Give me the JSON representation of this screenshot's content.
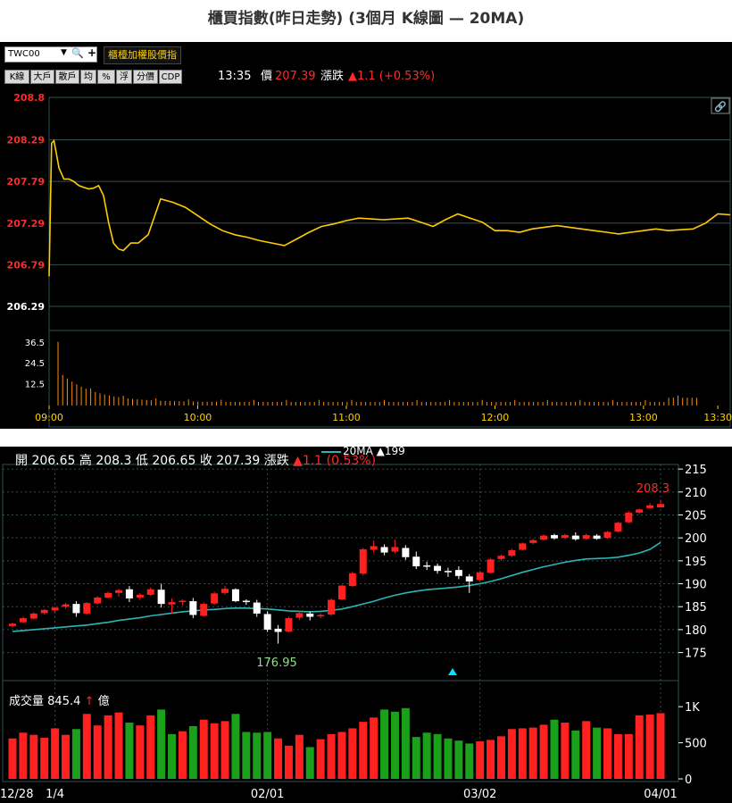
{
  "title": "櫃買指數(昨日走勢) (3個月 K線圖  — 20MA)",
  "top": {
    "symbol_input": "TWC00",
    "dropdown_icon": "▼",
    "search_icon": "🔍",
    "add_icon": "+",
    "name_button": "櫃檯加權股價指",
    "toolbar": [
      "K線",
      "大戶",
      "散戶",
      "均",
      "%",
      "浮",
      "分價",
      "CDP"
    ],
    "quote": {
      "time": "13:35",
      "price_label": "價",
      "price": "207.39",
      "change_label": "漲跌",
      "change": "▲1.1 (+0.53%)"
    },
    "price_ticks": [
      "208.8",
      "208.29",
      "207.79",
      "207.29",
      "206.79",
      "206.29"
    ],
    "volume_ticks": [
      "36.5",
      "24.5",
      "12.5"
    ],
    "time_ticks": [
      "09:00",
      "10:00",
      "11:00",
      "12:00",
      "13:00",
      "13:30"
    ],
    "colors": {
      "price_line": "#ffcc00",
      "volume": "#ff8a00",
      "grid": "#2f5050",
      "axis_text": "#ffd000",
      "price_tick": "#ff2a2a"
    }
  },
  "bottom": {
    "ohlc": {
      "open_label": "開",
      "open": "206.65",
      "high_label": "高",
      "high": "208.3",
      "low_label": "低",
      "low": "206.65",
      "close_label": "收",
      "close": "207.39",
      "change_label": "漲跌",
      "change": "▲1.1 (0.53%)"
    },
    "ma_legend": "20MA",
    "ma_value": "▲199",
    "high_annotation": "208.3",
    "low_annotation": "176.95",
    "price_ticks": [
      "215",
      "210",
      "205",
      "200",
      "195",
      "190",
      "185",
      "180",
      "175"
    ],
    "volume_label": "成交量",
    "volume_value": "845.4",
    "volume_arrow": "↑",
    "volume_unit": "億",
    "volume_ticks": [
      "1K",
      "500",
      "0"
    ],
    "date_ticks": [
      "12/28",
      "1/4",
      "02/01",
      "03/02",
      "04/01"
    ],
    "colors": {
      "up": "#ff2020",
      "down": "#ffffff",
      "ma": "#2bb5b5",
      "vol_up": "#ff2020",
      "vol_down": "#1aa01a"
    }
  },
  "chart_data": [
    {
      "type": "line",
      "title": "",
      "x_label": "",
      "y_label": "",
      "ylim": [
        206.29,
        208.8
      ],
      "x_range": [
        "09:00",
        "13:35"
      ],
      "series": [
        {
          "x": [
            "09:00",
            "09:01",
            "09:02",
            "09:04",
            "09:06",
            "09:08",
            "09:10",
            "09:12",
            "09:14",
            "09:16",
            "09:18",
            "09:20",
            "09:22",
            "09:24",
            "09:26",
            "09:28",
            "09:30",
            "09:33",
            "09:36",
            "09:40",
            "09:45",
            "09:50",
            "09:55",
            "10:00",
            "10:05",
            "10:10",
            "10:15",
            "10:20",
            "10:25",
            "10:30",
            "10:35",
            "10:40",
            "10:45",
            "10:50",
            "10:55",
            "11:00",
            "11:05",
            "11:10",
            "11:15",
            "11:20",
            "11:25",
            "11:30",
            "11:35",
            "11:40",
            "11:45",
            "11:50",
            "11:55",
            "12:00",
            "12:05",
            "12:10",
            "12:15",
            "12:20",
            "12:25",
            "12:30",
            "12:35",
            "12:40",
            "12:45",
            "12:50",
            "12:55",
            "13:00",
            "13:05",
            "13:10",
            "13:15",
            "13:20",
            "13:25",
            "13:30",
            "13:35"
          ],
          "values": [
            206.65,
            208.25,
            208.28,
            207.95,
            207.82,
            207.82,
            207.79,
            207.74,
            207.72,
            207.7,
            207.71,
            207.74,
            207.62,
            207.3,
            207.05,
            206.98,
            206.96,
            207.05,
            207.05,
            207.15,
            207.58,
            207.54,
            207.48,
            207.38,
            207.28,
            207.2,
            207.15,
            207.12,
            207.08,
            207.05,
            207.02,
            207.1,
            207.18,
            207.25,
            207.28,
            207.32,
            207.35,
            207.34,
            207.33,
            207.34,
            207.35,
            207.3,
            207.25,
            207.33,
            207.4,
            207.35,
            207.3,
            207.2,
            207.2,
            207.18,
            207.22,
            207.24,
            207.26,
            207.24,
            207.22,
            207.2,
            207.18,
            207.16,
            207.18,
            207.2,
            207.22,
            207.2,
            207.21,
            207.22,
            207.29,
            207.4,
            207.39
          ]
        }
      ],
      "volume": {
        "ylim": [
          0,
          40
        ],
        "peak_open": 36.5,
        "peak_close": 36.5
      }
    },
    {
      "type": "candlestick",
      "title": "",
      "x_label": "",
      "y_label": "",
      "ylim": [
        172,
        216
      ],
      "x_ticks": [
        "12/28",
        "1/4",
        "02/01",
        "03/02",
        "04/01"
      ],
      "series": [
        {
          "name": "K",
          "ohlc": [
            [
              180.8,
              181.5,
              180.5,
              181.3
            ],
            [
              181.6,
              182.8,
              181.4,
              182.5
            ],
            [
              182.4,
              183.8,
              182.2,
              183.5
            ],
            [
              183.6,
              184.5,
              183.3,
              184.3
            ],
            [
              184.2,
              185.0,
              183.8,
              184.8
            ],
            [
              185.0,
              185.8,
              184.6,
              185.5
            ],
            [
              185.6,
              186.2,
              182.8,
              183.6
            ],
            [
              183.5,
              186.0,
              183.2,
              185.8
            ],
            [
              185.7,
              187.3,
              185.5,
              187.0
            ],
            [
              187.0,
              188.3,
              186.8,
              188.0
            ],
            [
              188.0,
              188.9,
              187.2,
              188.6
            ],
            [
              188.8,
              189.5,
              186.0,
              186.8
            ],
            [
              187.0,
              188.0,
              186.5,
              187.6
            ],
            [
              187.6,
              189.2,
              187.4,
              188.8
            ],
            [
              188.7,
              190.0,
              184.8,
              185.6
            ],
            [
              185.5,
              186.8,
              183.5,
              186.0
            ],
            [
              186.1,
              186.6,
              185.3,
              186.3
            ],
            [
              186.2,
              186.9,
              182.5,
              183.2
            ],
            [
              183.0,
              185.9,
              182.8,
              185.6
            ],
            [
              185.7,
              188.3,
              185.4,
              187.9
            ],
            [
              188.0,
              189.5,
              187.6,
              188.9
            ],
            [
              188.8,
              189.0,
              186.0,
              186.2
            ],
            [
              186.3,
              186.6,
              185.4,
              186.0
            ],
            [
              185.9,
              186.5,
              182.8,
              183.5
            ],
            [
              183.4,
              184.0,
              179.5,
              180.0
            ],
            [
              180.2,
              181.0,
              176.95,
              179.5
            ],
            [
              179.6,
              182.8,
              179.4,
              182.5
            ],
            [
              182.6,
              184.2,
              182.1,
              183.6
            ],
            [
              183.5,
              184.0,
              182.0,
              182.8
            ],
            [
              182.9,
              183.5,
              182.5,
              183.2
            ],
            [
              183.3,
              186.8,
              183.0,
              186.5
            ],
            [
              186.6,
              189.8,
              186.4,
              189.6
            ],
            [
              189.5,
              192.6,
              189.3,
              192.3
            ],
            [
              192.2,
              197.8,
              191.8,
              197.5
            ],
            [
              197.4,
              199.4,
              196.8,
              198.2
            ],
            [
              198.0,
              198.6,
              196.2,
              196.8
            ],
            [
              197.0,
              199.6,
              196.6,
              198.0
            ],
            [
              197.8,
              198.4,
              195.2,
              195.8
            ],
            [
              195.9,
              197.0,
              193.2,
              193.8
            ],
            [
              194.0,
              194.8,
              193.0,
              193.8
            ],
            [
              193.9,
              194.4,
              192.2,
              192.8
            ],
            [
              192.8,
              193.5,
              191.5,
              192.6
            ],
            [
              193.0,
              193.8,
              191.0,
              191.7
            ],
            [
              191.6,
              192.1,
              188.0,
              190.5
            ],
            [
              190.8,
              192.8,
              190.6,
              192.5
            ],
            [
              192.4,
              195.6,
              192.2,
              195.3
            ],
            [
              195.4,
              196.4,
              195.0,
              196.1
            ],
            [
              196.1,
              197.6,
              195.8,
              197.3
            ],
            [
              197.4,
              199.0,
              197.2,
              198.8
            ],
            [
              198.9,
              199.8,
              198.6,
              199.5
            ],
            [
              199.6,
              200.8,
              199.4,
              200.5
            ],
            [
              200.6,
              200.9,
              199.6,
              199.9
            ],
            [
              200.0,
              200.9,
              199.8,
              200.6
            ],
            [
              200.5,
              201.2,
              199.4,
              199.7
            ],
            [
              199.8,
              200.9,
              199.6,
              200.6
            ],
            [
              200.5,
              200.8,
              199.6,
              199.8
            ],
            [
              200.0,
              201.5,
              199.8,
              201.3
            ],
            [
              201.4,
              203.5,
              201.2,
              203.3
            ],
            [
              203.4,
              205.8,
              203.2,
              205.5
            ],
            [
              205.5,
              206.4,
              205.2,
              206.2
            ],
            [
              206.5,
              207.6,
              206.3,
              207.1
            ],
            [
              206.65,
              208.3,
              206.65,
              207.39
            ]
          ]
        },
        {
          "name": "20MA",
          "values": [
            179.6,
            179.8,
            180.0,
            180.2,
            180.4,
            180.6,
            180.8,
            181.0,
            181.3,
            181.6,
            182.0,
            182.3,
            182.6,
            183.0,
            183.3,
            183.6,
            183.9,
            184.1,
            184.3,
            184.4,
            184.6,
            184.7,
            184.7,
            184.6,
            184.5,
            184.3,
            184.1,
            184.0,
            183.9,
            184.0,
            184.2,
            184.5,
            185.0,
            185.6,
            186.2,
            186.9,
            187.5,
            188.0,
            188.4,
            188.7,
            188.9,
            189.1,
            189.3,
            189.6,
            190.0,
            190.5,
            191.1,
            191.8,
            192.5,
            193.1,
            193.7,
            194.2,
            194.7,
            195.1,
            195.4,
            195.5,
            195.6,
            195.8,
            196.2,
            196.7,
            197.5,
            199.0
          ]
        }
      ],
      "volume": {
        "ylim": [
          0,
          1200
        ],
        "values": [
          560,
          640,
          610,
          570,
          700,
          610,
          690,
          900,
          740,
          880,
          920,
          780,
          740,
          880,
          960,
          620,
          660,
          730,
          820,
          770,
          800,
          900,
          650,
          640,
          650,
          560,
          460,
          610,
          440,
          550,
          620,
          650,
          700,
          790,
          850,
          960,
          930,
          980,
          580,
          640,
          620,
          560,
          530,
          490,
          520,
          540,
          590,
          690,
          700,
          710,
          750,
          820,
          780,
          670,
          800,
          710,
          700,
          620,
          620,
          880,
          890,
          910,
          845
        ],
        "up": [
          true,
          true,
          true,
          true,
          true,
          true,
          false,
          true,
          true,
          true,
          true,
          false,
          true,
          true,
          false,
          false,
          true,
          false,
          true,
          true,
          true,
          false,
          false,
          false,
          false,
          true,
          true,
          true,
          false,
          true,
          true,
          true,
          true,
          true,
          true,
          false,
          false,
          false,
          false,
          false,
          false,
          false,
          false,
          false,
          true,
          true,
          true,
          true,
          true,
          true,
          true,
          false,
          true,
          false,
          true,
          false,
          true,
          true,
          true,
          true,
          true,
          true,
          true
        ]
      }
    }
  ]
}
